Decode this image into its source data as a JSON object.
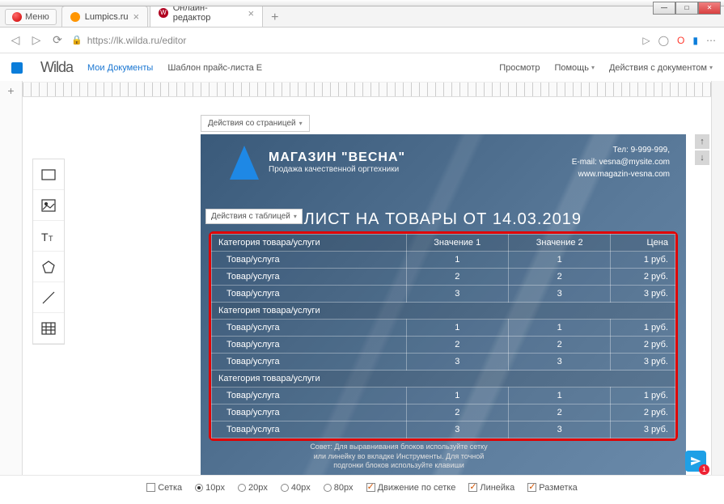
{
  "window": {
    "menu": "Меню"
  },
  "tabs": [
    {
      "label": "Lumpics.ru"
    },
    {
      "label": "Онлайн-редактор"
    }
  ],
  "addr": {
    "url": "https://lk.wilda.ru/editor"
  },
  "header": {
    "logo": "Wilda",
    "mydocs": "Мои Документы",
    "template": "Шаблон прайс-листа Е",
    "preview": "Просмотр",
    "help": "Помощь",
    "docactions": "Действия с документом"
  },
  "pageaction": "Действия со страницей",
  "tableaction": "Действия с таблицей",
  "doc": {
    "title": "МАГАЗИН \"ВЕСНА\"",
    "subtitle": "Продажа качественной оргтехники",
    "phone": "Тел: 9-999-999,",
    "email": "E-mail: vesna@mysite.com",
    "site": "www.magazin-vesna.com",
    "heading": "-ЛИСТ НА ТОВАРЫ ОТ 14.03.2019"
  },
  "table": {
    "headers": {
      "cat": "Категория товара/услуги",
      "v1": "Значение 1",
      "v2": "Значение 2",
      "price": "Цена"
    },
    "catlabel": "Категория товара/услуги",
    "rowlabel": "Товар/услуга",
    "groups": [
      {
        "rows": [
          {
            "v1": "1",
            "v2": "1",
            "p": "1 руб."
          },
          {
            "v1": "2",
            "v2": "2",
            "p": "2 руб."
          },
          {
            "v1": "3",
            "v2": "3",
            "p": "3 руб."
          }
        ]
      },
      {
        "rows": [
          {
            "v1": "1",
            "v2": "1",
            "p": "1 руб."
          },
          {
            "v1": "2",
            "v2": "2",
            "p": "2 руб."
          },
          {
            "v1": "3",
            "v2": "3",
            "p": "3 руб."
          }
        ]
      },
      {
        "rows": [
          {
            "v1": "1",
            "v2": "1",
            "p": "1 руб."
          },
          {
            "v1": "2",
            "v2": "2",
            "p": "2 руб."
          },
          {
            "v1": "3",
            "v2": "3",
            "p": "3 руб."
          }
        ]
      }
    ]
  },
  "tip": "Совет: Для выравнивания блоков используйте сетку или линейку во вкладке Инструменты. Для точной подгонки блоков используйте клавиши",
  "footer": {
    "grid": "Сетка",
    "px": [
      "10px",
      "20px",
      "40px",
      "80px"
    ],
    "snap": "Движение по сетке",
    "ruler": "Линейка",
    "layout": "Разметка"
  }
}
